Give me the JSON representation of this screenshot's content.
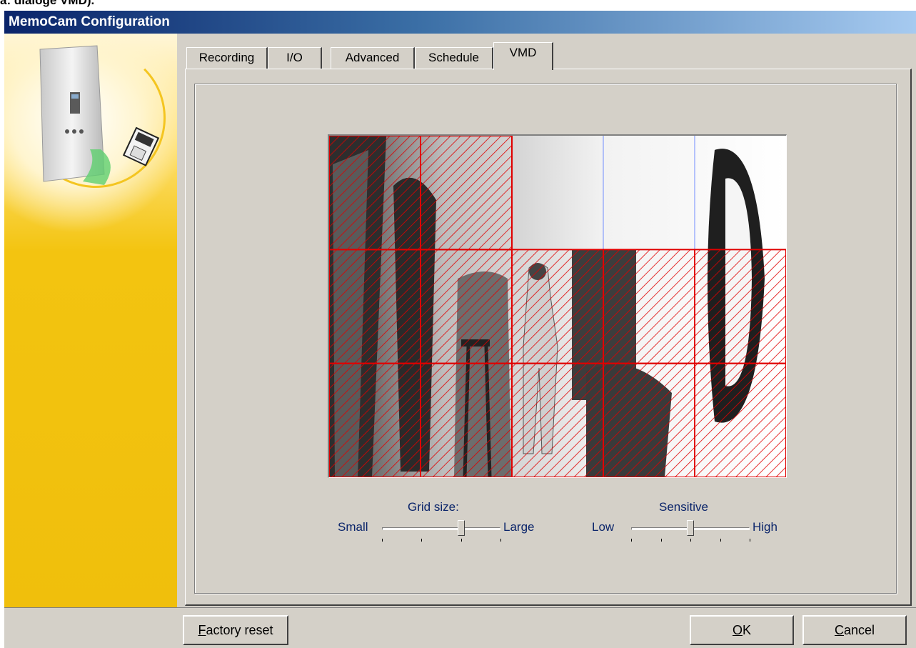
{
  "page_caption": "a: dialoge VMD).",
  "window": {
    "title": "MemoCam Configuration"
  },
  "tabs": [
    {
      "label": "Recording",
      "active": false
    },
    {
      "label": "I/O",
      "active": false
    },
    {
      "label": "Advanced",
      "active": false
    },
    {
      "label": "Schedule",
      "active": false
    },
    {
      "label": "VMD",
      "active": true
    }
  ],
  "vmd": {
    "grid": {
      "columns": 5,
      "rows": 3,
      "selected_cells": [
        [
          0,
          0
        ],
        [
          0,
          1
        ],
        [
          1,
          0
        ],
        [
          1,
          1
        ],
        [
          1,
          2
        ],
        [
          1,
          3
        ],
        [
          1,
          4
        ],
        [
          2,
          0
        ],
        [
          2,
          1
        ],
        [
          2,
          2
        ],
        [
          2,
          3
        ],
        [
          2,
          4
        ]
      ]
    },
    "grid_size": {
      "title": "Grid size:",
      "min_label": "Small",
      "max_label": "Large",
      "position": 0.67,
      "ticks": 4
    },
    "sensitive": {
      "title": "Sensitive",
      "min_label": "Low",
      "max_label": "High",
      "position": 0.5,
      "ticks": 5
    }
  },
  "buttons": {
    "factory_reset": {
      "accel": "F",
      "rest": "actory reset"
    },
    "ok": {
      "accel": "O",
      "rest": "K"
    },
    "cancel": {
      "accel": "C",
      "rest": "ancel"
    }
  },
  "colors": {
    "selection": "#e00000",
    "grid_line": "#6f8cff",
    "title_start": "#0a246a",
    "title_end": "#a6caf0"
  }
}
